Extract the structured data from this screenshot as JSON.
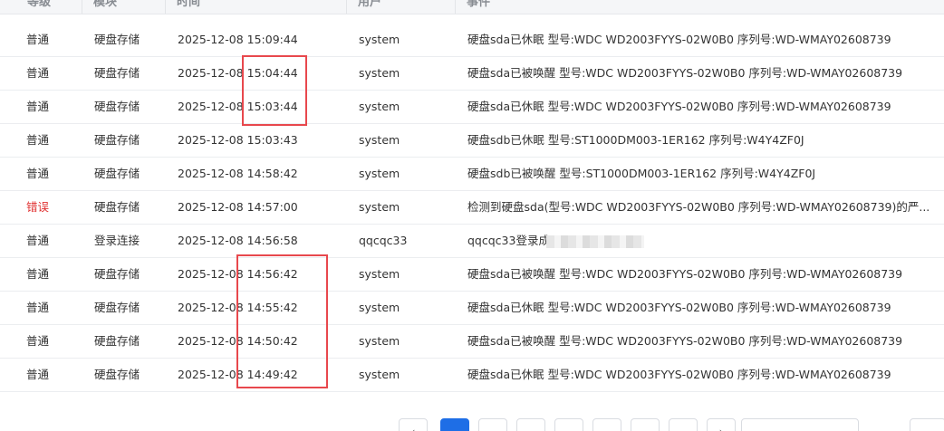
{
  "columns": [
    "等级",
    "模块",
    "时间",
    "用户",
    "事件"
  ],
  "rows": [
    {
      "level": "普通",
      "module": "硬盘存储",
      "time": "2025-12-08 15:09:44",
      "user": "system",
      "event": "硬盘sda已休眠 型号:WDC WD2003FYYS-02W0B0 序列号:WD-WMAY02608739"
    },
    {
      "level": "普通",
      "module": "硬盘存储",
      "time": "2025-12-08 15:04:44",
      "user": "system",
      "event": "硬盘sda已被唤醒 型号:WDC WD2003FYYS-02W0B0 序列号:WD-WMAY02608739"
    },
    {
      "level": "普通",
      "module": "硬盘存储",
      "time": "2025-12-08 15:03:44",
      "user": "system",
      "event": "硬盘sda已休眠 型号:WDC WD2003FYYS-02W0B0 序列号:WD-WMAY02608739"
    },
    {
      "level": "普通",
      "module": "硬盘存储",
      "time": "2025-12-08 15:03:43",
      "user": "system",
      "event": "硬盘sdb已休眠 型号:ST1000DM003-1ER162 序列号:W4Y4ZF0J"
    },
    {
      "level": "普通",
      "module": "硬盘存储",
      "time": "2025-12-08 14:58:42",
      "user": "system",
      "event": "硬盘sdb已被唤醒 型号:ST1000DM003-1ER162 序列号:W4Y4ZF0J"
    },
    {
      "level": "错误",
      "module": "硬盘存储",
      "time": "2025-12-08 14:57:00",
      "user": "system",
      "event": "检测到硬盘sda(型号:WDC WD2003FYYS-02W0B0 序列号:WD-WMAY02608739)的严..."
    },
    {
      "level": "普通",
      "module": "登录连接",
      "time": "2025-12-08 14:56:58",
      "user": "qqcqc33",
      "event": "qqcqc33登录成"
    },
    {
      "level": "普通",
      "module": "硬盘存储",
      "time": "2025-12-08 14:56:42",
      "user": "system",
      "event": "硬盘sda已被唤醒 型号:WDC WD2003FYYS-02W0B0 序列号:WD-WMAY02608739"
    },
    {
      "level": "普通",
      "module": "硬盘存储",
      "time": "2025-12-08 14:55:42",
      "user": "system",
      "event": "硬盘sda已休眠 型号:WDC WD2003FYYS-02W0B0 序列号:WD-WMAY02608739"
    },
    {
      "level": "普通",
      "module": "硬盘存储",
      "time": "2025-12-08 14:50:42",
      "user": "system",
      "event": "硬盘sda已被唤醒 型号:WDC WD2003FYYS-02W0B0 序列号:WD-WMAY02608739"
    },
    {
      "level": "普通",
      "module": "硬盘存储",
      "time": "2025-12-08 14:49:42",
      "user": "system",
      "event": "硬盘sda已休眠 型号:WDC WD2003FYYS-02W0B0 序列号:WD-WMAY02608739"
    }
  ],
  "colors": {
    "error": "#e03131",
    "highlight": "#e8484d",
    "active_page": "#1e6ee6"
  }
}
